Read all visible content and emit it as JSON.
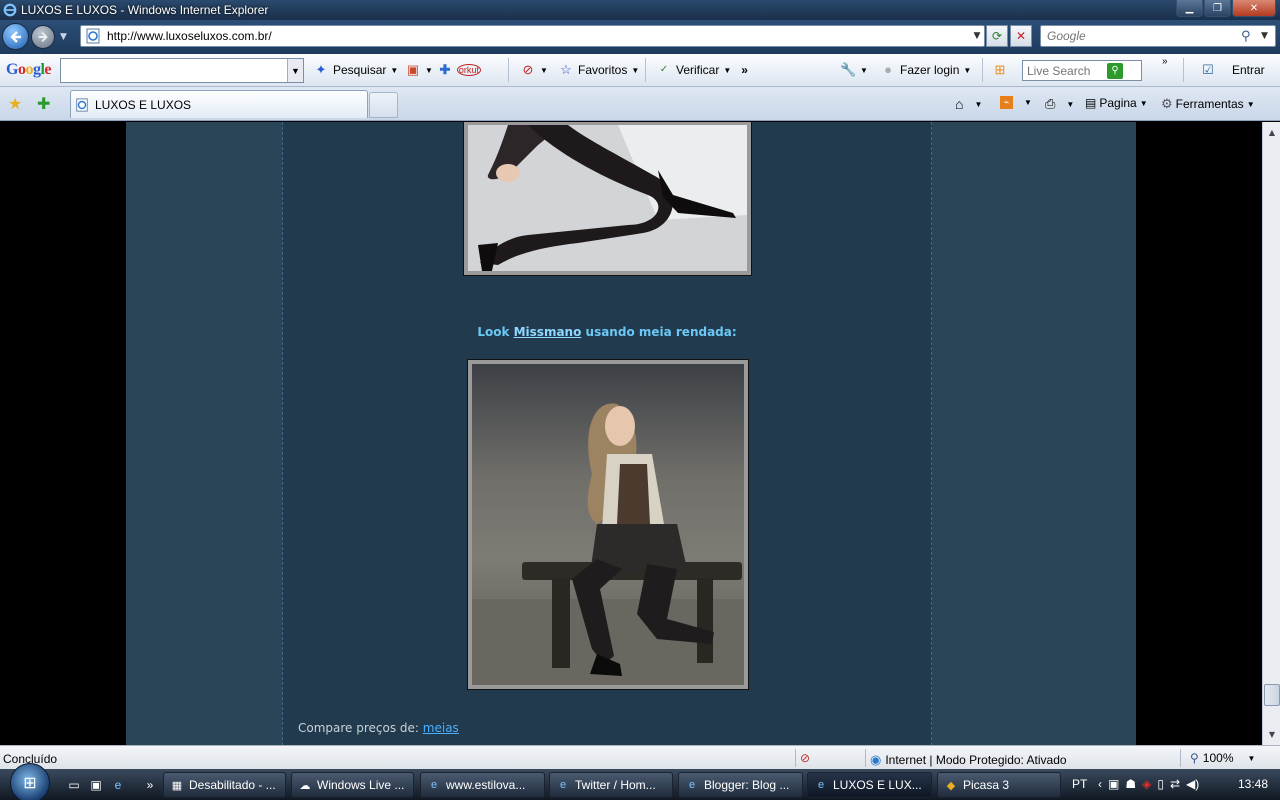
{
  "window": {
    "title": "LUXOS E LUXOS - Windows Internet Explorer"
  },
  "nav": {
    "url": "http://www.luxoseluxos.com.br/",
    "search_placeholder": "Google"
  },
  "google_toolbar": {
    "logo": "Google",
    "pesquisar": "Pesquisar",
    "favoritos": "Favoritos",
    "verificar": "Verificar",
    "chevron": "»",
    "fazer_login": "Fazer login",
    "live_search_placeholder": "Live Search",
    "entrar": "Entrar",
    "orkut": "orkut"
  },
  "tabs": {
    "active_label": "LUXOS E LUXOS"
  },
  "commands": {
    "pagina": "Pagina",
    "ferramentas": "Ferramentas"
  },
  "page": {
    "caption_prefix": "Look ",
    "caption_link": "Missmano",
    "caption_suffix": " usando meia rendada:",
    "compare_prefix": "Compare preços de: ",
    "compare_link": "meias"
  },
  "status": {
    "text": "Concluído",
    "zone": "Internet | Modo Protegido: Ativado",
    "zoom": "100%"
  },
  "taskbar": {
    "items": [
      {
        "label": "Desabilitado - ..."
      },
      {
        "label": "Windows Live ..."
      },
      {
        "label": "www.estilova..."
      },
      {
        "label": "Twitter / Hom..."
      },
      {
        "label": "Blogger: Blog ..."
      },
      {
        "label": "LUXOS E LUX..."
      },
      {
        "label": "Picasa 3"
      }
    ],
    "lang": "PT",
    "clock": "13:48"
  },
  "colors": {
    "page_bg": "#000000",
    "outer_panel": "#2a4458",
    "main_panel": "#213a4e",
    "caption": "#6cc8f5",
    "link": "#4ab0ff"
  }
}
